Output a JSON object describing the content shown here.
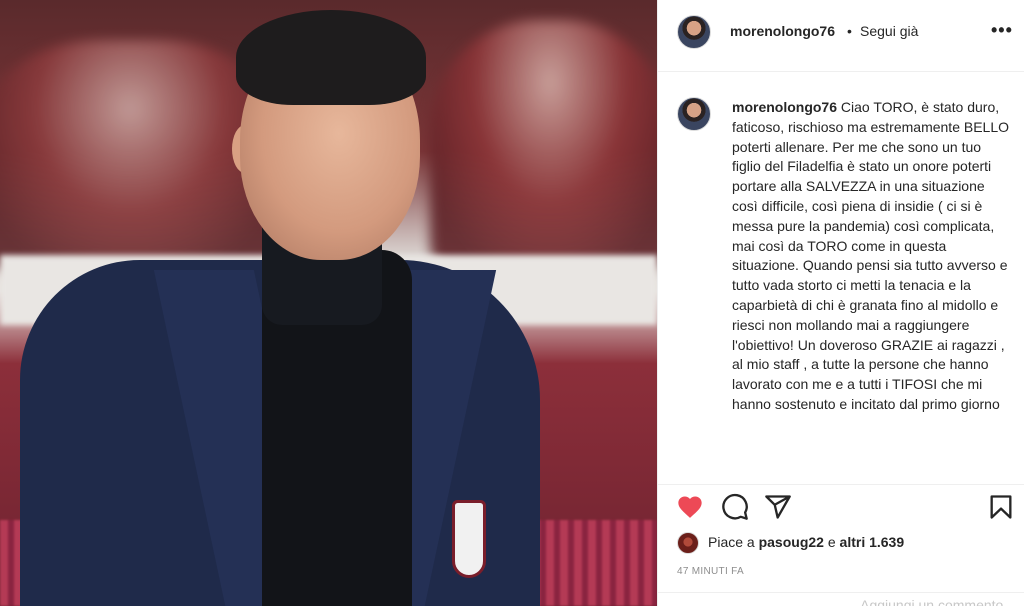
{
  "post": {
    "username": "morenolongo76",
    "separator": "•",
    "follow_status": "Segui già",
    "more_label": "•••"
  },
  "caption": {
    "username": "morenolongo76",
    "text": "Ciao TORO, è stato duro, faticoso, rischioso ma estremamente BELLO poterti allenare. Per me che sono un tuo figlio del Filadelfia è stato un onore poterti portare alla SALVEZZA in una situazione così difficile, così piena di insidie ( ci si è messa pure la pandemia) così complicata, mai così da TORO come in questa situazione. Quando pensi sia tutto avverso e tutto vada storto ci metti la tenacia e la caparbietà di chi è granata fino al midollo e riesci non mollando mai a raggiungere l'obiettivo! Un doveroso GRAZIE ai ragazzi , al mio staff , a tutte la persone che hanno lavorato con me e a tutti i TIFOSI che mi hanno sostenuto e incitato dal primo giorno"
  },
  "actions": {
    "liked_color": "#ed4956",
    "icons": [
      "heart-icon",
      "comment-icon",
      "share-icon",
      "bookmark-icon"
    ]
  },
  "likes": {
    "prefix": "Piace a",
    "user": "pasoug22",
    "middle": "e",
    "others": "altri 1.639"
  },
  "timestamp": "47 MINUTI FA",
  "comment_placeholder": "Aggiungi un commento..."
}
